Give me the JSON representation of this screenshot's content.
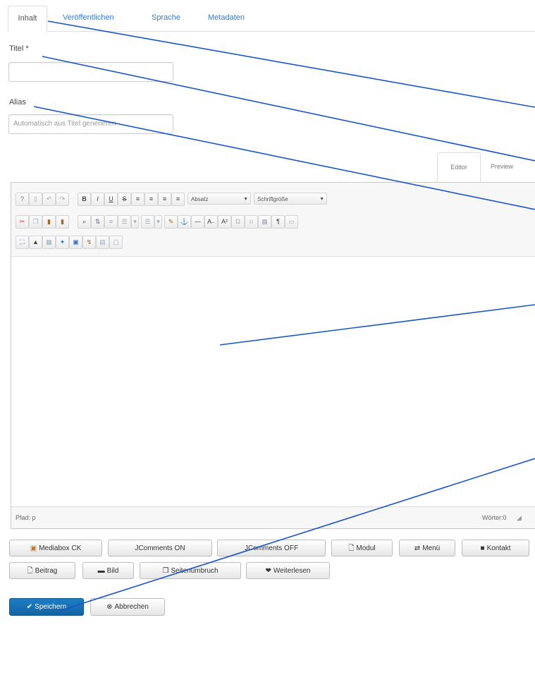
{
  "tabs": [
    {
      "label": "Inhalt",
      "active": true
    },
    {
      "label": "Veröffentlichen"
    },
    {
      "label": "Sprache"
    },
    {
      "label": "Metadaten"
    }
  ],
  "form": {
    "title_label": "Titel *",
    "title_value": "",
    "alias_label": "Alias",
    "alias_placeholder": "Automatisch aus Titel generieren"
  },
  "editor": {
    "tabs": [
      "Editor",
      "Preview"
    ],
    "toolbar": {
      "format_select": "Absatz",
      "fontsize_select": "Schriftgröße"
    },
    "status_path": "Pfad: p",
    "status_words": "Wörter:0",
    "content": ""
  },
  "extension_buttons": {
    "row1": [
      {
        "label": "Mediabox CK",
        "icon": "image-icon"
      },
      {
        "label": "JComments ON",
        "icon": ""
      },
      {
        "label": "JComments OFF",
        "icon": ""
      },
      {
        "label": "Modul",
        "icon": "file-icon"
      },
      {
        "label": "Menü",
        "icon": "share-icon"
      },
      {
        "label": "Kontakt",
        "icon": "contact-icon"
      }
    ],
    "row2": [
      {
        "label": "Beitrag",
        "icon": "file-icon"
      },
      {
        "label": "Bild",
        "icon": "picture-icon"
      },
      {
        "label": "Seitenumbruch",
        "icon": "copy-icon"
      },
      {
        "label": "Weiterlesen",
        "icon": "chevron-icon"
      }
    ]
  },
  "actions": {
    "save": "Speichern",
    "cancel": "Abbrechen"
  },
  "annotation_color": "#1a55c4"
}
